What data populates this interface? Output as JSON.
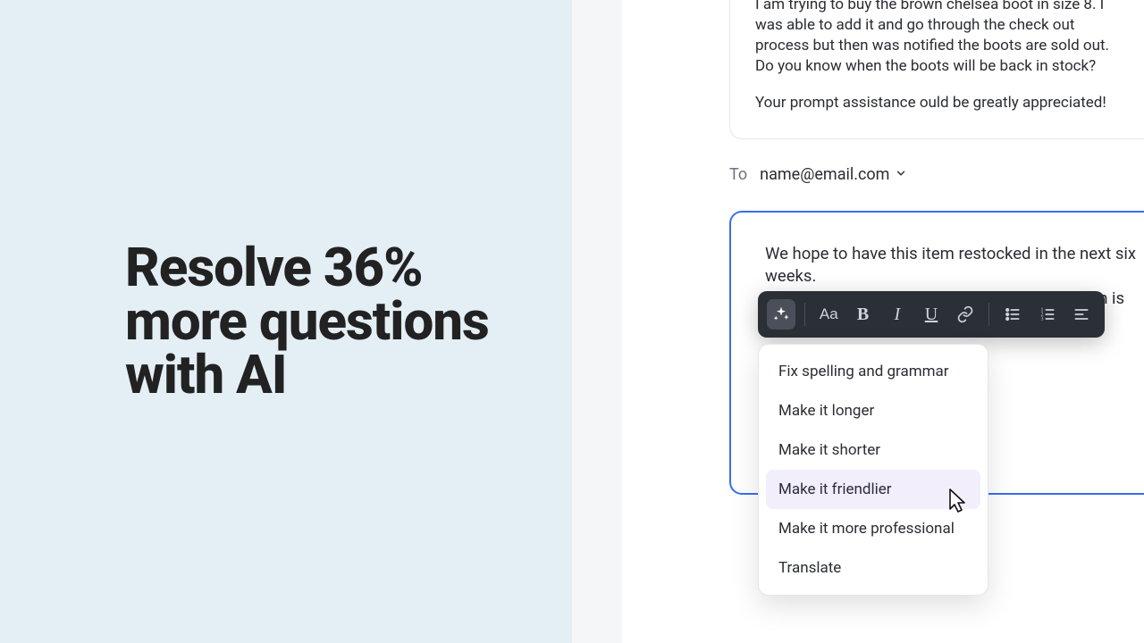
{
  "headline": "Resolve 36% more questions with AI",
  "incoming": {
    "p1": "I am trying to buy the brown chelsea boot in size 8. I was able to add it and go through the check out process but then was notified the boots are sold out. Do you know when the boots will be back in stock?",
    "p2": "Your prompt assistance ould be greatly appreciated!"
  },
  "to": {
    "label": "To",
    "email": "name@email.com"
  },
  "compose": {
    "text": "We hope to have this item restocked in the next six weeks.\nYou can subscribe to be notified when the item is available."
  },
  "toolbar": {
    "ai_label": "AI assist",
    "aa": "Aa",
    "bold": "B",
    "italic": "I",
    "underline": "U"
  },
  "ai_menu": {
    "items": [
      "Fix spelling and grammar",
      "Make it longer",
      "Make it shorter",
      "Make it friendlier",
      "Make it more professional",
      "Translate"
    ],
    "hover_index": 3
  }
}
